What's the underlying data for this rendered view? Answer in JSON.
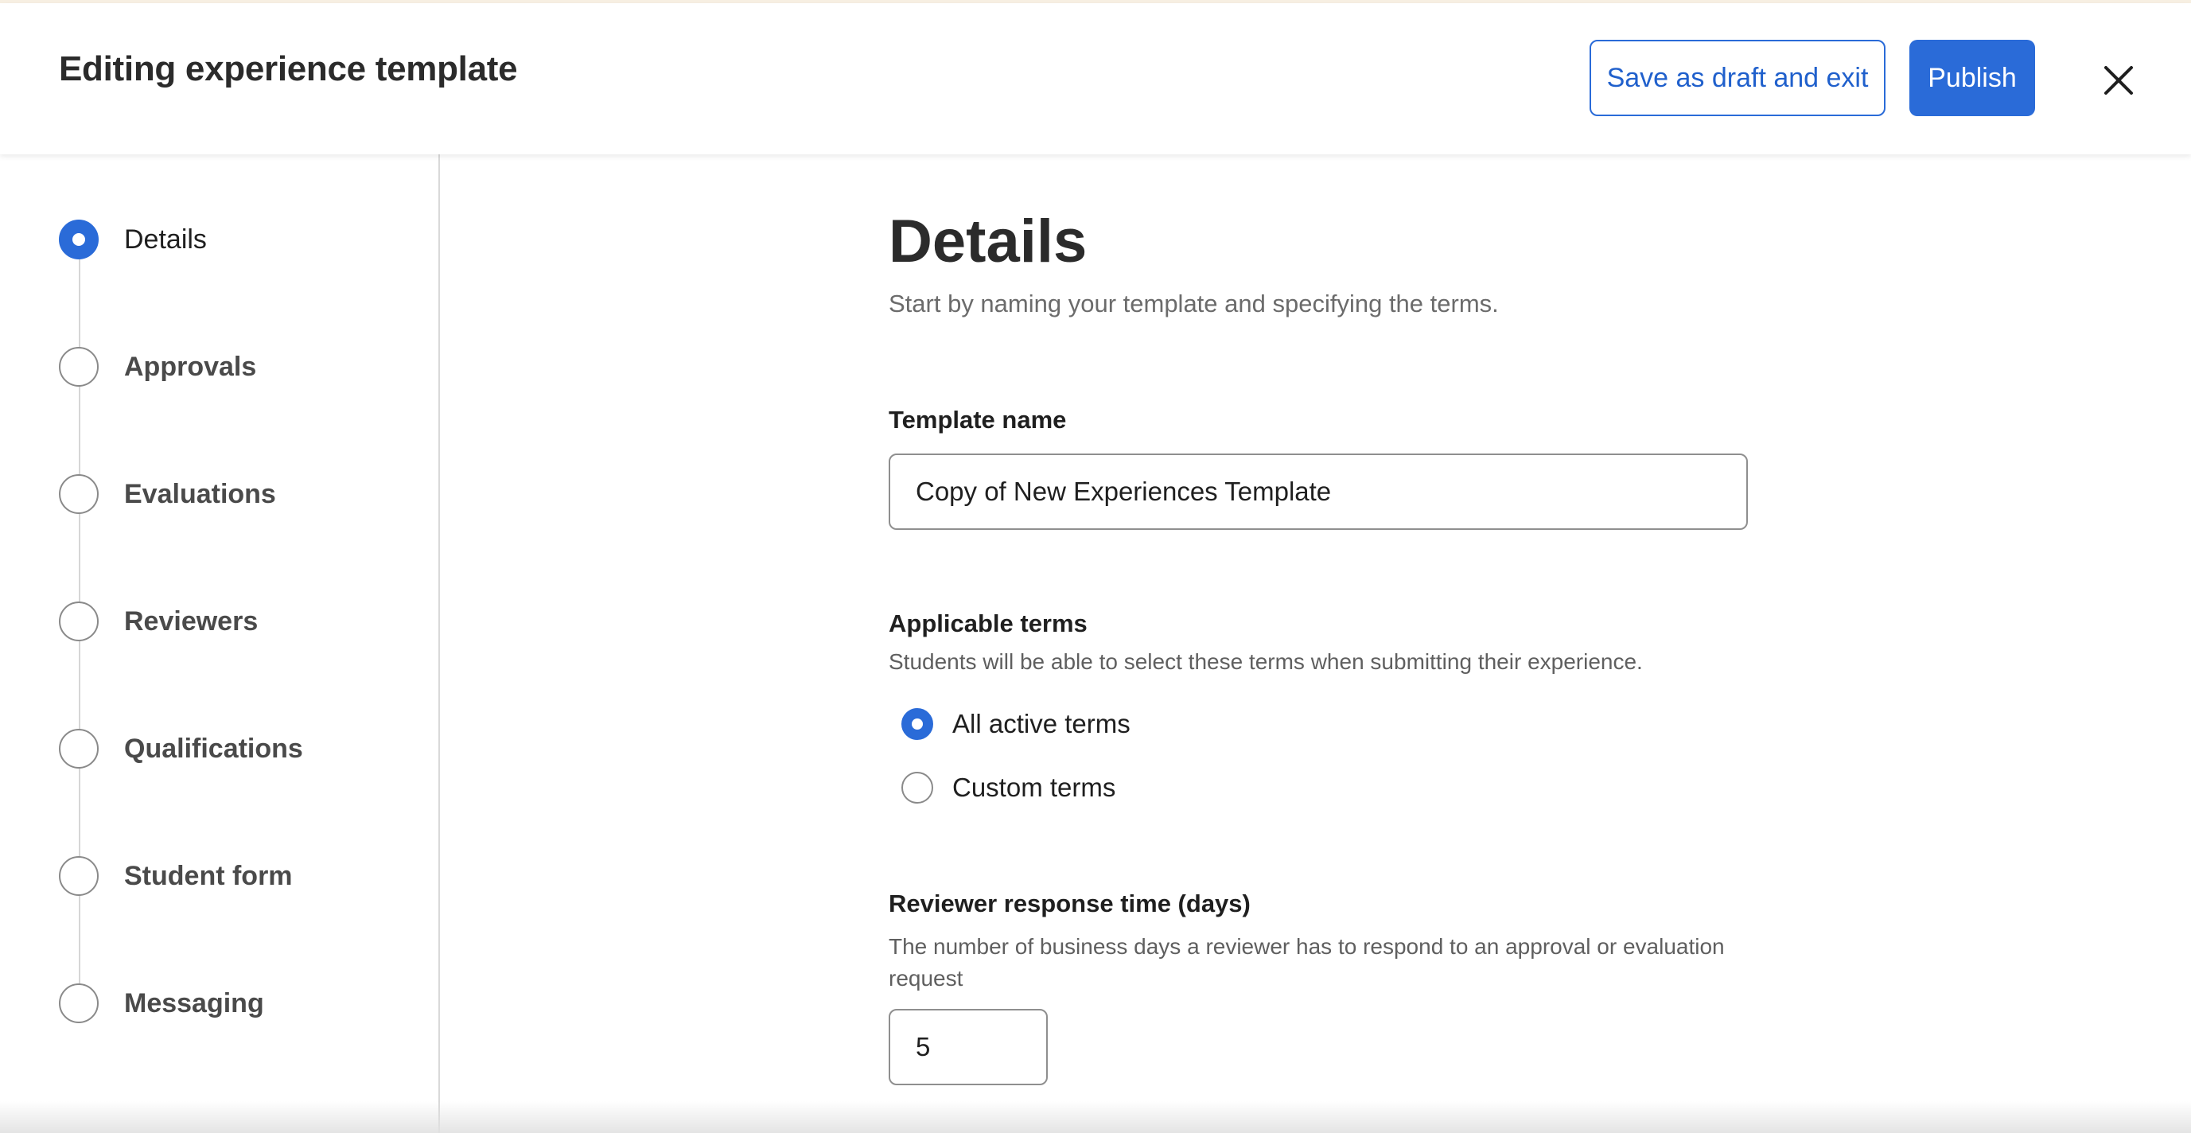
{
  "header": {
    "title": "Editing experience template",
    "save_draft_label": "Save as draft and exit",
    "publish_label": "Publish",
    "close_icon": "close-icon"
  },
  "colors": {
    "accent": "#2a6bd8",
    "top_accent": "#f7efe2"
  },
  "sidebar": {
    "steps": [
      {
        "label": "Details",
        "active": true
      },
      {
        "label": "Approvals",
        "active": false
      },
      {
        "label": "Evaluations",
        "active": false
      },
      {
        "label": "Reviewers",
        "active": false
      },
      {
        "label": "Qualifications",
        "active": false
      },
      {
        "label": "Student form",
        "active": false
      },
      {
        "label": "Messaging",
        "active": false
      }
    ]
  },
  "main": {
    "title": "Details",
    "subtitle": "Start by naming your template and specifying the terms.",
    "template_name": {
      "label": "Template name",
      "value": "Copy of New Experiences Template"
    },
    "applicable_terms": {
      "label": "Applicable terms",
      "helper": "Students will be able to select these terms when submitting their experience.",
      "options": [
        {
          "label": "All active terms",
          "checked": true
        },
        {
          "label": "Custom terms",
          "checked": false
        }
      ]
    },
    "response_time": {
      "label": "Reviewer response time (days)",
      "helper": "The number of business days a reviewer has to respond to an approval or evaluation request",
      "value": "5"
    }
  }
}
